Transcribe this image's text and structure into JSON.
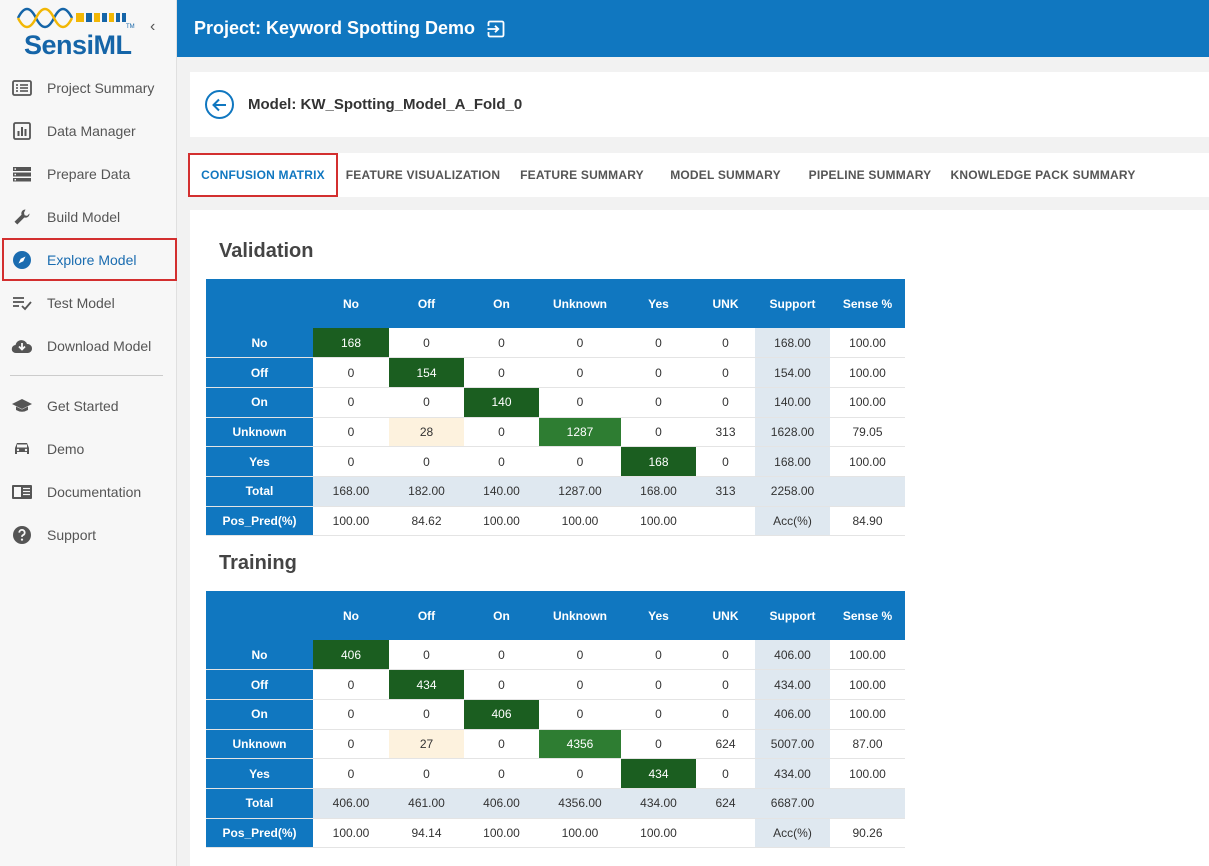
{
  "app": {
    "logo_text": "SensiML",
    "logo_tm": "TM",
    "project_title": "Project: Keyword Spotting Demo"
  },
  "sidebar": {
    "items": [
      {
        "label": "Project Summary",
        "icon": "list-icon"
      },
      {
        "label": "Data Manager",
        "icon": "chart-box-icon"
      },
      {
        "label": "Prepare Data",
        "icon": "stack-icon"
      },
      {
        "label": "Build Model",
        "icon": "wrench-icon"
      },
      {
        "label": "Explore Model",
        "icon": "compass-icon",
        "active": true
      },
      {
        "label": "Test Model",
        "icon": "checklist-icon"
      },
      {
        "label": "Download Model",
        "icon": "cloud-download-icon"
      }
    ],
    "secondary": [
      {
        "label": "Get Started",
        "icon": "graduation-cap-icon"
      },
      {
        "label": "Demo",
        "icon": "car-icon"
      },
      {
        "label": "Documentation",
        "icon": "book-icon"
      },
      {
        "label": "Support",
        "icon": "help-icon"
      }
    ]
  },
  "model": {
    "title": "Model: KW_Spotting_Model_A_Fold_0"
  },
  "tabs": [
    {
      "label": "CONFUSION MATRIX",
      "active": true
    },
    {
      "label": "FEATURE VISUALIZATION"
    },
    {
      "label": "FEATURE SUMMARY"
    },
    {
      "label": "MODEL SUMMARY"
    },
    {
      "label": "PIPELINE SUMMARY"
    },
    {
      "label": "KNOWLEDGE PACK SUMMARY"
    }
  ],
  "colors": {
    "brand_blue": "#1077c0",
    "diag_dark": "#1b5e20",
    "diag_mid": "#2e7d32",
    "off_diag_light": "#fdf2de",
    "support_bg": "#dfe8f0",
    "highlight_red": "#d32f2f"
  },
  "validation": {
    "title": "Validation",
    "headers": [
      "",
      "No",
      "Off",
      "On",
      "Unknown",
      "Yes",
      "UNK",
      "Support",
      "Sense %"
    ],
    "rows": [
      {
        "label": "No",
        "cells": [
          "168",
          "0",
          "0",
          "0",
          "0",
          "0"
        ],
        "support": "168.00",
        "sense": "100.00",
        "diag": 0,
        "diag_style": "dark"
      },
      {
        "label": "Off",
        "cells": [
          "0",
          "154",
          "0",
          "0",
          "0",
          "0"
        ],
        "support": "154.00",
        "sense": "100.00",
        "diag": 1,
        "diag_style": "dark"
      },
      {
        "label": "On",
        "cells": [
          "0",
          "0",
          "140",
          "0",
          "0",
          "0"
        ],
        "support": "140.00",
        "sense": "100.00",
        "diag": 2,
        "diag_style": "dark"
      },
      {
        "label": "Unknown",
        "cells": [
          "0",
          "28",
          "0",
          "1287",
          "0",
          "313"
        ],
        "support": "1628.00",
        "sense": "79.05",
        "diag": 3,
        "diag_style": "mid",
        "light": 1
      },
      {
        "label": "Yes",
        "cells": [
          "0",
          "0",
          "0",
          "0",
          "168",
          "0"
        ],
        "support": "168.00",
        "sense": "100.00",
        "diag": 4,
        "diag_style": "dark"
      }
    ],
    "total": {
      "label": "Total",
      "cells": [
        "168.00",
        "182.00",
        "140.00",
        "1287.00",
        "168.00",
        "313"
      ],
      "support": "2258.00",
      "sense": ""
    },
    "pos_pred": {
      "label": "Pos_Pred(%)",
      "cells": [
        "100.00",
        "84.62",
        "100.00",
        "100.00",
        "100.00",
        ""
      ],
      "support": "Acc(%)",
      "sense": "84.90"
    }
  },
  "training": {
    "title": "Training",
    "headers": [
      "",
      "No",
      "Off",
      "On",
      "Unknown",
      "Yes",
      "UNK",
      "Support",
      "Sense %"
    ],
    "rows": [
      {
        "label": "No",
        "cells": [
          "406",
          "0",
          "0",
          "0",
          "0",
          "0"
        ],
        "support": "406.00",
        "sense": "100.00",
        "diag": 0,
        "diag_style": "dark"
      },
      {
        "label": "Off",
        "cells": [
          "0",
          "434",
          "0",
          "0",
          "0",
          "0"
        ],
        "support": "434.00",
        "sense": "100.00",
        "diag": 1,
        "diag_style": "dark"
      },
      {
        "label": "On",
        "cells": [
          "0",
          "0",
          "406",
          "0",
          "0",
          "0"
        ],
        "support": "406.00",
        "sense": "100.00",
        "diag": 2,
        "diag_style": "dark"
      },
      {
        "label": "Unknown",
        "cells": [
          "0",
          "27",
          "0",
          "4356",
          "0",
          "624"
        ],
        "support": "5007.00",
        "sense": "87.00",
        "diag": 3,
        "diag_style": "mid",
        "light": 1
      },
      {
        "label": "Yes",
        "cells": [
          "0",
          "0",
          "0",
          "0",
          "434",
          "0"
        ],
        "support": "434.00",
        "sense": "100.00",
        "diag": 4,
        "diag_style": "dark"
      }
    ],
    "total": {
      "label": "Total",
      "cells": [
        "406.00",
        "461.00",
        "406.00",
        "4356.00",
        "434.00",
        "624"
      ],
      "support": "6687.00",
      "sense": ""
    },
    "pos_pred": {
      "label": "Pos_Pred(%)",
      "cells": [
        "100.00",
        "94.14",
        "100.00",
        "100.00",
        "100.00",
        ""
      ],
      "support": "Acc(%)",
      "sense": "90.26"
    }
  }
}
